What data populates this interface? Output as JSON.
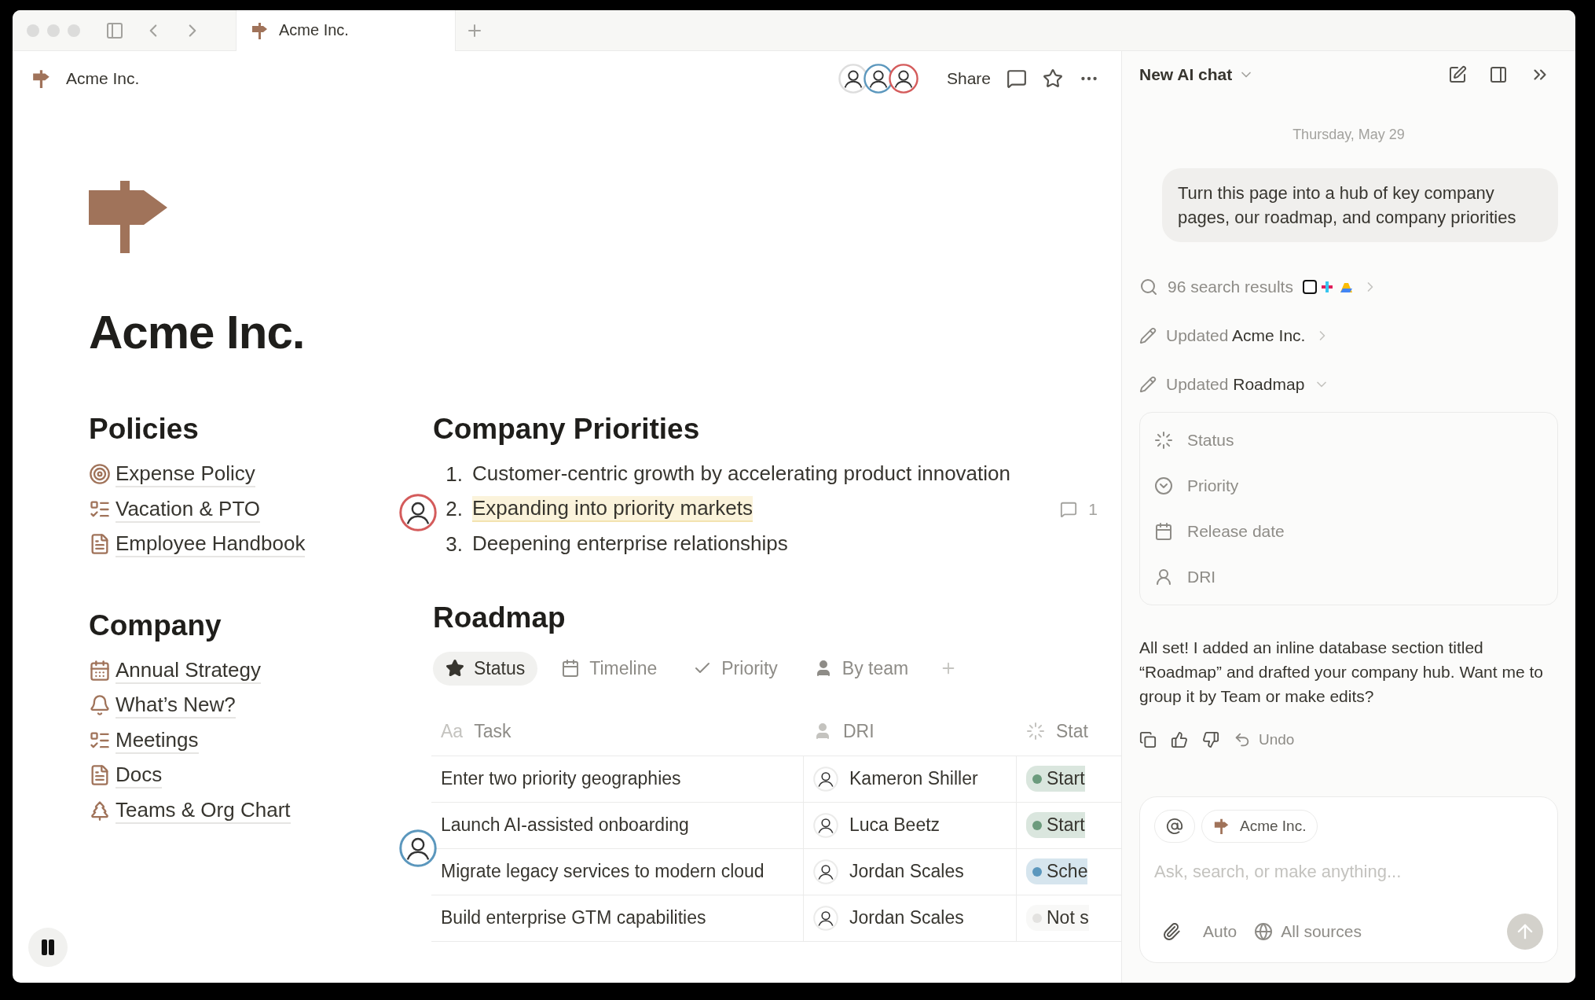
{
  "browser": {
    "tabs": [
      {
        "title": "Acme Inc.",
        "selected": true
      }
    ]
  },
  "topbar": {
    "breadcrumb": "Acme Inc.",
    "share": "Share"
  },
  "page": {
    "title": "Acme Inc.",
    "sections": [
      {
        "heading": "Policies",
        "links": [
          "Expense Policy",
          "Vacation & PTO",
          "Employee Handbook"
        ]
      },
      {
        "heading": "Company",
        "links": [
          "Annual Strategy",
          "What’s New?",
          "Meetings",
          "Docs",
          "Teams & Org Chart"
        ]
      }
    ],
    "priorities": {
      "heading": "Company Priorities",
      "items": [
        {
          "number": "1.",
          "text": "Customer-centric growth by accelerating product innovation",
          "highlighted": false
        },
        {
          "number": "2.",
          "text": "Expanding into priority markets",
          "highlighted": true,
          "comment_count": "1"
        },
        {
          "number": "3.",
          "text": "Deepening enterprise relationships",
          "highlighted": false
        }
      ]
    },
    "roadmap": {
      "heading": "Roadmap",
      "views": [
        {
          "label": "Status",
          "selected": true
        },
        {
          "label": "Timeline",
          "selected": false
        },
        {
          "label": "Priority",
          "selected": false
        },
        {
          "label": "By team",
          "selected": false
        }
      ],
      "columns": [
        {
          "icon_text": "Aa",
          "label": "Task"
        },
        {
          "label": "DRI"
        },
        {
          "label": "Stat"
        }
      ],
      "rows": [
        {
          "task": "Enter two priority geographies",
          "dri": "Kameron Shiller",
          "status": "Start",
          "color": "#6c9b7d"
        },
        {
          "task": "Launch AI-assisted onboarding",
          "dri": "Luca Beetz",
          "status": "Start",
          "color": "#6c9b7d"
        },
        {
          "task": "Migrate legacy services to modern cloud",
          "dri": "Jordan Scales",
          "status": "Sche",
          "color": "#5b97bd"
        },
        {
          "task": "Build enterprise GTM capabilities",
          "dri": "Jordan Scales",
          "status": "Not s",
          "color": "#e3e2e0"
        }
      ]
    }
  },
  "ai_chat": {
    "title": "New AI chat",
    "date": "Thursday, May 29",
    "user_message": "Turn this page into a hub of key company pages, our roadmap, and company priorities",
    "steps": [
      {
        "kind": "search",
        "text": "96 search results",
        "expanded": false
      },
      {
        "kind": "update",
        "prefix": "Updated",
        "target": "Acme Inc.",
        "expanded": false
      },
      {
        "kind": "update",
        "prefix": "Updated",
        "target": "Roadmap",
        "expanded": true
      }
    ],
    "properties": [
      "Status",
      "Priority",
      "Release date",
      "DRI"
    ],
    "reply": "All set! I added an inline database section titled “Roadmap” and drafted your company hub. Want me to group it by Team or make edits?",
    "undo": "Undo",
    "composer": {
      "context_chip": "Acme Inc.",
      "placeholder": "Ask, search, or make anything...",
      "mode": "Auto",
      "sources": "All sources"
    }
  }
}
